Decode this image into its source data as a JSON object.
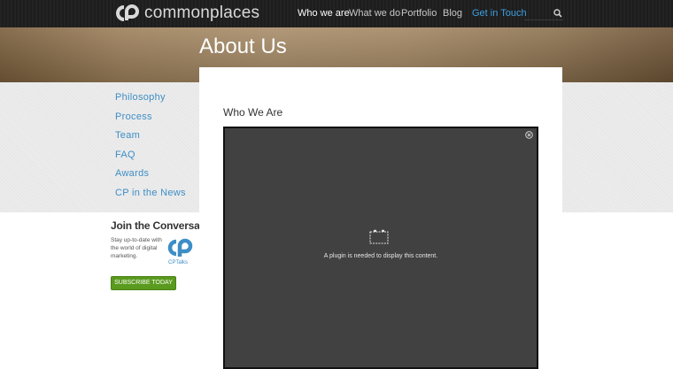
{
  "header": {
    "logo_text": "commonplaces",
    "nav": [
      {
        "label": "Who we are",
        "state": "active"
      },
      {
        "label": "What we do",
        "state": ""
      },
      {
        "label": "Portfolio",
        "state": ""
      },
      {
        "label": "Blog",
        "state": ""
      },
      {
        "label": "Get in Touch",
        "state": "cta"
      }
    ],
    "search_placeholder": ""
  },
  "hero": {
    "title": "About Us"
  },
  "sidebar": {
    "items": [
      {
        "label": "Philosophy"
      },
      {
        "label": "Process"
      },
      {
        "label": "Team"
      },
      {
        "label": "FAQ"
      },
      {
        "label": "Awards"
      },
      {
        "label": "CP in the News"
      }
    ]
  },
  "join": {
    "title": "Join the Conversation",
    "text": "Stay up-to-date with the world of digital marketing.",
    "brand": "CPTalks",
    "button": "SUBSCRIBE TODAY"
  },
  "main": {
    "section_title": "Who We Are",
    "plugin_message": "A plugin is needed to display this content."
  },
  "colors": {
    "link_blue": "#3d8ec6",
    "cta_blue": "#3ea0e0",
    "subscribe_green": "#5a9a1e",
    "nav_bg": "#1f1f1f",
    "plugin_bg": "#414141"
  },
  "icons": [
    "commonplaces-logo-icon",
    "search-icon",
    "cptalks-logo-icon",
    "close-icon",
    "plugin-icon"
  ]
}
